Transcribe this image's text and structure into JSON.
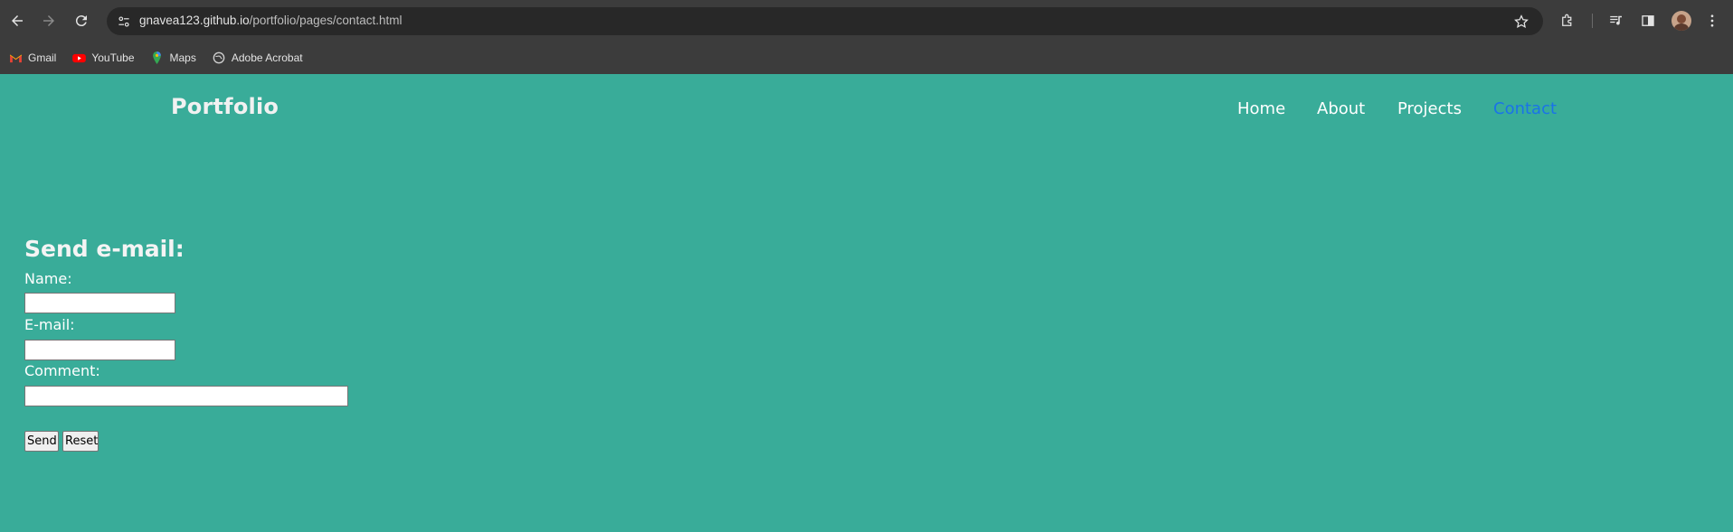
{
  "browser": {
    "url_host": "gnavea123.github.io",
    "url_path": "/portfolio/pages/contact.html",
    "bookmarks": [
      {
        "label": "Gmail",
        "icon": "gmail-icon"
      },
      {
        "label": "YouTube",
        "icon": "youtube-icon"
      },
      {
        "label": "Maps",
        "icon": "maps-icon"
      },
      {
        "label": "Adobe Acrobat",
        "icon": "globe-icon"
      }
    ]
  },
  "header": {
    "logo": "Portfolio",
    "nav": [
      {
        "label": "Home"
      },
      {
        "label": "About"
      },
      {
        "label": "Projects"
      },
      {
        "label": "Contact",
        "active": true
      }
    ]
  },
  "form": {
    "title": "Send e-mail:",
    "name_label": "Name:",
    "name_value": "",
    "email_label": "E-mail:",
    "email_value": "",
    "comment_label": "Comment:",
    "comment_value": "",
    "send_label": "Send",
    "reset_label": "Reset"
  },
  "colors": {
    "page_background": "#39ac99",
    "active_link": "#1a73e8",
    "chrome_background": "#3c3c3c"
  }
}
